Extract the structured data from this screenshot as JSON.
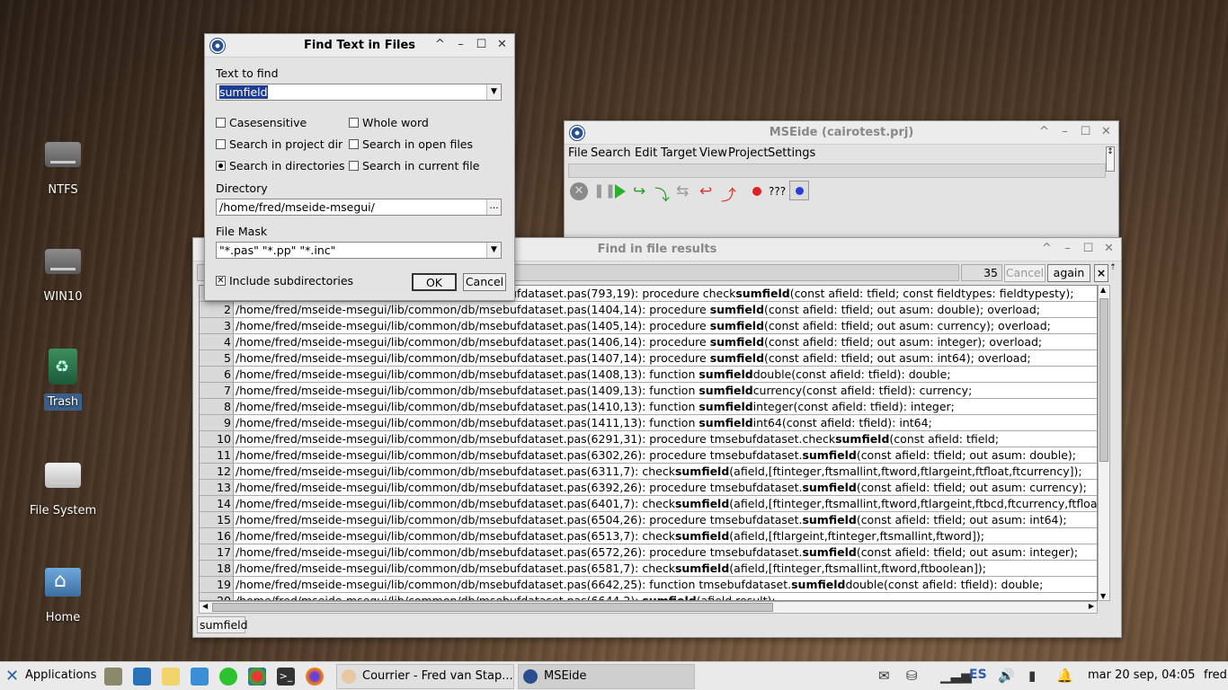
{
  "desktop": {
    "icons": [
      {
        "label": "NTFS"
      },
      {
        "label": "WIN10"
      },
      {
        "label": "Trash"
      },
      {
        "label": "File System"
      },
      {
        "label": "Home"
      }
    ]
  },
  "ide": {
    "title": "MSEide (cairotest.prj)",
    "menu": [
      "File",
      "Search",
      "Edit",
      "Target",
      "View",
      "Project",
      "Settings"
    ],
    "toolbar_unknown": "???"
  },
  "find_dialog": {
    "title": "Find Text in Files",
    "text_label": "Text to find",
    "text_value": "sumfield",
    "casesensitive": "Casesensitive",
    "whole_word": "Whole word",
    "search_project": "Search in project dir",
    "search_open": "Search in open files",
    "search_dirs": "Search in directories",
    "search_current": "Search in current file",
    "search_dirs_selected": true,
    "dir_label": "Directory",
    "dir_value": "/home/fred/mseide-msegui/",
    "dir_btn": "...",
    "mask_label": "File Mask",
    "mask_value": "\"*.pas\" \"*.pp\" \"*.inc\"",
    "include_sub": "Include subdirectories",
    "include_sub_checked": true,
    "ok": "OK",
    "cancel": "Cancel"
  },
  "results": {
    "title": "Find in file results",
    "count": "35",
    "cancel": "Cancel",
    "again": "again",
    "close": "×",
    "status": "sumfield",
    "rows": [
      {
        "n": "1",
        "pre": "/home/fred/mseide-msegui/lib/common/db/msebufdataset.pas(793,19):    procedure check",
        "hit": "sumfield",
        "post": "(const afield: tfield; const fieldtypes: fieldtypesty);"
      },
      {
        "n": "2",
        "pre": "/home/fred/mseide-msegui/lib/common/db/msebufdataset.pas(1404,14):    procedure ",
        "hit": "sumfield",
        "post": "(const afield: tfield; out asum: double); overload;"
      },
      {
        "n": "3",
        "pre": "/home/fred/mseide-msegui/lib/common/db/msebufdataset.pas(1405,14):    procedure ",
        "hit": "sumfield",
        "post": "(const afield: tfield; out asum: currency); overload;"
      },
      {
        "n": "4",
        "pre": "/home/fred/mseide-msegui/lib/common/db/msebufdataset.pas(1406,14):    procedure ",
        "hit": "sumfield",
        "post": "(const afield: tfield; out asum: integer); overload;"
      },
      {
        "n": "5",
        "pre": "/home/fred/mseide-msegui/lib/common/db/msebufdataset.pas(1407,14):    procedure ",
        "hit": "sumfield",
        "post": "(const afield: tfield; out asum: int64); overload;"
      },
      {
        "n": "6",
        "pre": "/home/fred/mseide-msegui/lib/common/db/msebufdataset.pas(1408,13):    function ",
        "hit": "sumfield",
        "post": "double(const afield: tfield): double;"
      },
      {
        "n": "7",
        "pre": "/home/fred/mseide-msegui/lib/common/db/msebufdataset.pas(1409,13):    function ",
        "hit": "sumfield",
        "post": "currency(const afield: tfield): currency;"
      },
      {
        "n": "8",
        "pre": "/home/fred/mseide-msegui/lib/common/db/msebufdataset.pas(1410,13):    function ",
        "hit": "sumfield",
        "post": "integer(const afield: tfield): integer;"
      },
      {
        "n": "9",
        "pre": "/home/fred/mseide-msegui/lib/common/db/msebufdataset.pas(1411,13):    function ",
        "hit": "sumfield",
        "post": "int64(const afield: tfield): int64;"
      },
      {
        "n": "10",
        "pre": "/home/fred/mseide-msegui/lib/common/db/msebufdataset.pas(6291,31): procedure tmsebufdataset.check",
        "hit": "sumfield",
        "post": "(const afield: tfield;"
      },
      {
        "n": "11",
        "pre": "/home/fred/mseide-msegui/lib/common/db/msebufdataset.pas(6302,26): procedure tmsebufdataset.",
        "hit": "sumfield",
        "post": "(const afield: tfield; out asum: double);"
      },
      {
        "n": "12",
        "pre": "/home/fred/mseide-msegui/lib/common/db/msebufdataset.pas(6311,7):  check",
        "hit": "sumfield",
        "post": "(afield,[ftinteger,ftsmallint,ftword,ftlargeint,ftfloat,ftcurrency]);"
      },
      {
        "n": "13",
        "pre": "/home/fred/mseide-msegui/lib/common/db/msebufdataset.pas(6392,26): procedure tmsebufdataset.",
        "hit": "sumfield",
        "post": "(const afield: tfield; out asum: currency);"
      },
      {
        "n": "14",
        "pre": "/home/fred/mseide-msegui/lib/common/db/msebufdataset.pas(6401,7):  check",
        "hit": "sumfield",
        "post": "(afield,[ftinteger,ftsmallint,ftword,ftlargeint,ftbcd,ftcurrency,ftfloat]);"
      },
      {
        "n": "15",
        "pre": "/home/fred/mseide-msegui/lib/common/db/msebufdataset.pas(6504,26): procedure tmsebufdataset.",
        "hit": "sumfield",
        "post": "(const afield: tfield; out asum: int64);"
      },
      {
        "n": "16",
        "pre": "/home/fred/mseide-msegui/lib/common/db/msebufdataset.pas(6513,7):  check",
        "hit": "sumfield",
        "post": "(afield,[ftlargeint,ftinteger,ftsmallint,ftword]);"
      },
      {
        "n": "17",
        "pre": "/home/fred/mseide-msegui/lib/common/db/msebufdataset.pas(6572,26): procedure tmsebufdataset.",
        "hit": "sumfield",
        "post": "(const afield: tfield; out asum: integer);"
      },
      {
        "n": "18",
        "pre": "/home/fred/mseide-msegui/lib/common/db/msebufdataset.pas(6581,7):  check",
        "hit": "sumfield",
        "post": "(afield,[ftinteger,ftsmallint,ftword,ftboolean]);"
      },
      {
        "n": "19",
        "pre": "/home/fred/mseide-msegui/lib/common/db/msebufdataset.pas(6642,25): function tmsebufdataset.",
        "hit": "sumfield",
        "post": "double(const afield: tfield): double;"
      },
      {
        "n": "20",
        "pre": "/home/fred/mseide-msegui/lib/common/db/msebufdataset.pas(6644,2):  ",
        "hit": "sumfield",
        "post": "(afield,result);"
      }
    ]
  },
  "taskbar": {
    "apps_label": "Applications",
    "task1": "Courrier - Fred van Stap...",
    "task2": "MSEide",
    "lang": "ES",
    "clock": "mar 20 sep, 04:05",
    "user": "fred"
  }
}
